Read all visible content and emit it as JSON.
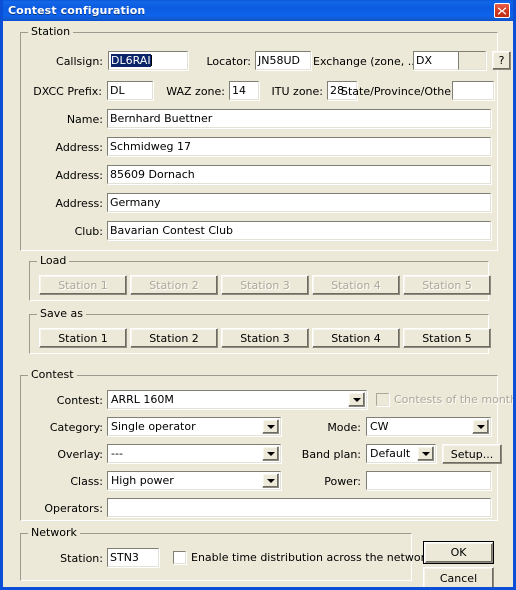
{
  "window": {
    "title": "Contest configuration",
    "close_icon": "close-icon",
    "accent_title_color": "#0A57D4",
    "face_color": "#ECE9D8"
  },
  "station": {
    "legend": "Station",
    "callsign": {
      "label": "Callsign:",
      "value": "DL6RAI",
      "selected": true
    },
    "locator": {
      "label": "Locator:",
      "value": "JN58UD"
    },
    "exchange": {
      "label": "Exchange (zone, ...):",
      "value": "DX"
    },
    "exchange_extra": {
      "value": ""
    },
    "help_button": {
      "label": "?"
    },
    "dxcc_prefix": {
      "label": "DXCC Prefix:",
      "value": "DL"
    },
    "waz_zone": {
      "label": "WAZ zone:",
      "value": "14"
    },
    "itu_zone": {
      "label": "ITU zone:",
      "value": "28"
    },
    "state_province": {
      "label": "State/Province/Other:",
      "value": ""
    },
    "name": {
      "label": "Name:",
      "value": "Bernhard Buettner"
    },
    "address1": {
      "label": "Address:",
      "value": "Schmidweg 17"
    },
    "address2": {
      "label": "Address:",
      "value": "85609 Dornach"
    },
    "address3": {
      "label": "Address:",
      "value": "Germany"
    },
    "club": {
      "label": "Club:",
      "value": "Bavarian Contest Club"
    }
  },
  "load": {
    "legend": "Load",
    "buttons": [
      {
        "label": "Station 1",
        "disabled": true
      },
      {
        "label": "Station 2",
        "disabled": true
      },
      {
        "label": "Station 3",
        "disabled": true
      },
      {
        "label": "Station 4",
        "disabled": true
      },
      {
        "label": "Station 5",
        "disabled": true
      }
    ]
  },
  "save_as": {
    "legend": "Save as",
    "buttons": [
      {
        "label": "Station 1",
        "disabled": false
      },
      {
        "label": "Station 2",
        "disabled": false
      },
      {
        "label": "Station 3",
        "disabled": false
      },
      {
        "label": "Station 4",
        "disabled": false
      },
      {
        "label": "Station 5",
        "disabled": false
      }
    ]
  },
  "contest": {
    "legend": "Contest",
    "contest": {
      "label": "Contest:",
      "value": "ARRL 160M"
    },
    "contests_of_month": {
      "label": "Contests of the month",
      "checked": false,
      "disabled": true
    },
    "category": {
      "label": "Category:",
      "value": "Single operator"
    },
    "mode": {
      "label": "Mode:",
      "value": "CW"
    },
    "overlay": {
      "label": "Overlay:",
      "value": "---"
    },
    "band_plan": {
      "label": "Band plan:",
      "value": "Default"
    },
    "setup_button": {
      "label": "Setup..."
    },
    "class": {
      "label": "Class:",
      "value": "High power"
    },
    "power": {
      "label": "Power:",
      "value": ""
    },
    "operators": {
      "label": "Operators:",
      "value": ""
    }
  },
  "network": {
    "legend": "Network",
    "station": {
      "label": "Station:",
      "value": "STN3"
    },
    "enable_time_distribution": {
      "label": "Enable time distribution across the network",
      "checked": false
    }
  },
  "actions": {
    "ok": "OK",
    "cancel": "Cancel"
  }
}
